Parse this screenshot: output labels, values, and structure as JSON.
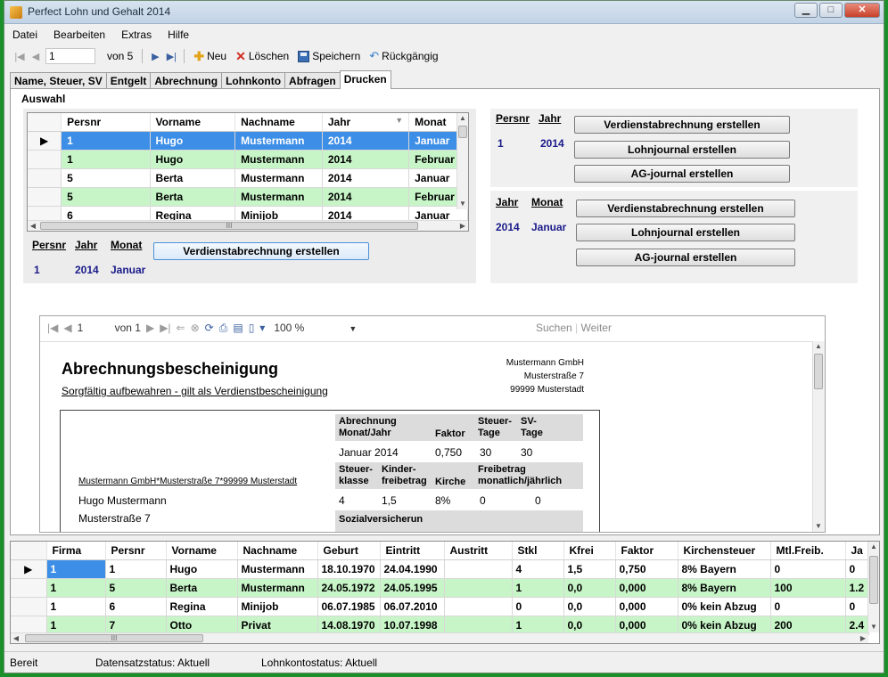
{
  "window": {
    "title": "Perfect Lohn und Gehalt 2014",
    "min": "▁",
    "max": "□",
    "close": "✕"
  },
  "menu": [
    "Datei",
    "Bearbeiten",
    "Extras",
    "Hilfe"
  ],
  "toolbar": {
    "record": "1",
    "of": "von 5",
    "new": "Neu",
    "delete": "Löschen",
    "save": "Speichern",
    "undo": "Rückgängig"
  },
  "tabs": [
    "Name, Steuer, SV",
    "Entgelt",
    "Abrechnung",
    "Lohnkonto",
    "Abfragen",
    "Drucken"
  ],
  "auswahl": {
    "title": "Auswahl",
    "columns": [
      "Persnr",
      "Vorname",
      "Nachname",
      "Jahr",
      "Monat"
    ],
    "rows": [
      [
        "1",
        "Hugo",
        "Mustermann",
        "2014",
        "Januar"
      ],
      [
        "1",
        "Hugo",
        "Mustermann",
        "2014",
        "Februar"
      ],
      [
        "5",
        "Berta",
        "Mustermann",
        "2014",
        "Januar"
      ],
      [
        "5",
        "Berta",
        "Mustermann",
        "2014",
        "Februar"
      ],
      [
        "6",
        "Regina",
        "Minijob",
        "2014",
        "Januar"
      ]
    ],
    "hscroll_mark": "III",
    "sel_labels": [
      "Persnr",
      "Jahr",
      "Monat"
    ],
    "sel_values": [
      "1",
      "2014",
      "Januar"
    ],
    "button": "Verdienstabrechnung erstellen"
  },
  "right1": {
    "labels": [
      "Persnr",
      "Jahr"
    ],
    "values": [
      "1",
      "2014"
    ],
    "buttons": [
      "Verdienstabrechnung erstellen",
      "Lohnjournal erstellen",
      "AG-journal erstellen"
    ]
  },
  "right2": {
    "labels": [
      "Jahr",
      "Monat"
    ],
    "values": [
      "2014",
      "Januar"
    ],
    "buttons": [
      "Verdienstabrechnung erstellen",
      "Lohnjournal erstellen",
      "AG-journal erstellen"
    ]
  },
  "report": {
    "page": "1",
    "of": "von 1",
    "zoom": "100 %",
    "search": "Suchen",
    "next": "Weiter",
    "title": "Abrechnungsbescheinigung",
    "subtitle": "Sorgfältig aufbewahren - gilt als Verdienstbescheinigung",
    "address": [
      "Mustermann GmbH",
      "Musterstraße 7",
      "99999 Musterstadt"
    ],
    "sender_line": "Mustermann GmbH*Musterstraße 7*99999 Musterstadt",
    "employee": "Hugo Mustermann",
    "street": "Musterstraße 7",
    "h1": "Abrechnung Monat/Jahr",
    "h2": "Faktor",
    "h3": "Steuer- Tage",
    "h4": "SV- Tage",
    "v1": "Januar 2014",
    "v2": "0,750",
    "v3": "30",
    "v4": "30",
    "h5": "Steuer- klasse",
    "h6": "Kinder- freibetrag",
    "h7": "Kirche",
    "h8": "Freibetrag monatlich/jährlich",
    "v5": "4",
    "v6": "1,5",
    "v7": "8%",
    "v8a": "0",
    "v8b": "0",
    "h9": "Sozialversicherun"
  },
  "bottom": {
    "columns": [
      "Firma",
      "Persnr",
      "Vorname",
      "Nachname",
      "Geburt",
      "Eintritt",
      "Austritt",
      "Stkl",
      "Kfrei",
      "Faktor",
      "Kirchensteuer",
      "Mtl.Freib.",
      "Ja"
    ],
    "rows": [
      [
        "1",
        "1",
        "Hugo",
        "Mustermann",
        "18.10.1970",
        "24.04.1990",
        "",
        "4",
        "1,5",
        "0,750",
        "8% Bayern",
        "0",
        "0"
      ],
      [
        "1",
        "5",
        "Berta",
        "Mustermann",
        "24.05.1972",
        "24.05.1995",
        "",
        "1",
        "0,0",
        "0,000",
        "8% Bayern",
        "100",
        "1.2"
      ],
      [
        "1",
        "6",
        "Regina",
        "Minijob",
        "06.07.1985",
        "06.07.2010",
        "",
        "0",
        "0,0",
        "0,000",
        "0% kein Abzug",
        "0",
        "0"
      ],
      [
        "1",
        "7",
        "Otto",
        "Privat",
        "14.08.1970",
        "10.07.1998",
        "",
        "1",
        "0,0",
        "0,000",
        "0% kein Abzug",
        "200",
        "2.4"
      ]
    ],
    "hscroll_mark": "III"
  },
  "status": {
    "ready": "Bereit",
    "record_status": "Datensatzstatus:  Aktuell",
    "account_status": "Lohnkontostatus:  Aktuell"
  },
  "colors": {
    "selection": "#3d8ee6",
    "alt_row": "#c7f5c7",
    "value_blue": "#1a1a8a",
    "background": "#1a8f2a"
  }
}
